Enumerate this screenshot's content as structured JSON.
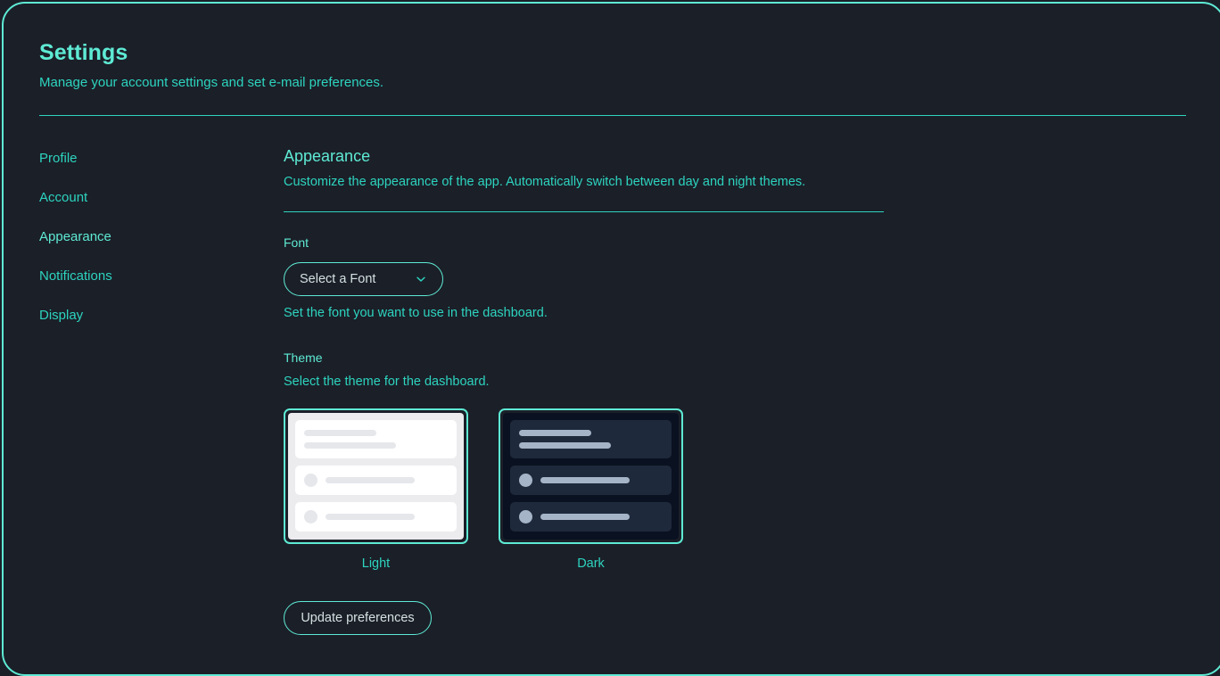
{
  "header": {
    "title": "Settings",
    "subtitle": "Manage your account settings and set e-mail preferences."
  },
  "sidebar": {
    "items": [
      {
        "label": "Profile",
        "active": false
      },
      {
        "label": "Account",
        "active": false
      },
      {
        "label": "Appearance",
        "active": true
      },
      {
        "label": "Notifications",
        "active": false
      },
      {
        "label": "Display",
        "active": false
      }
    ]
  },
  "section": {
    "title": "Appearance",
    "description": "Customize the appearance of the app. Automatically switch between day and night themes."
  },
  "font_field": {
    "label": "Font",
    "selected_value": "Select a Font",
    "help": "Set the font you want to use in the dashboard.",
    "chevron_icon": "chevron-down-icon"
  },
  "theme_field": {
    "label": "Theme",
    "help": "Select the theme for the dashboard.",
    "options": [
      {
        "id": "light",
        "caption": "Light",
        "selected": true
      },
      {
        "id": "dark",
        "caption": "Dark",
        "selected": true
      }
    ]
  },
  "actions": {
    "update_label": "Update preferences"
  },
  "colors": {
    "background": "#1b1f28",
    "accent": "#5eead4",
    "accent_muted": "#2dd4bf",
    "frame_border": "#5eead4",
    "light_preview_bg": "#ececef",
    "dark_preview_bg": "#0a1120"
  }
}
